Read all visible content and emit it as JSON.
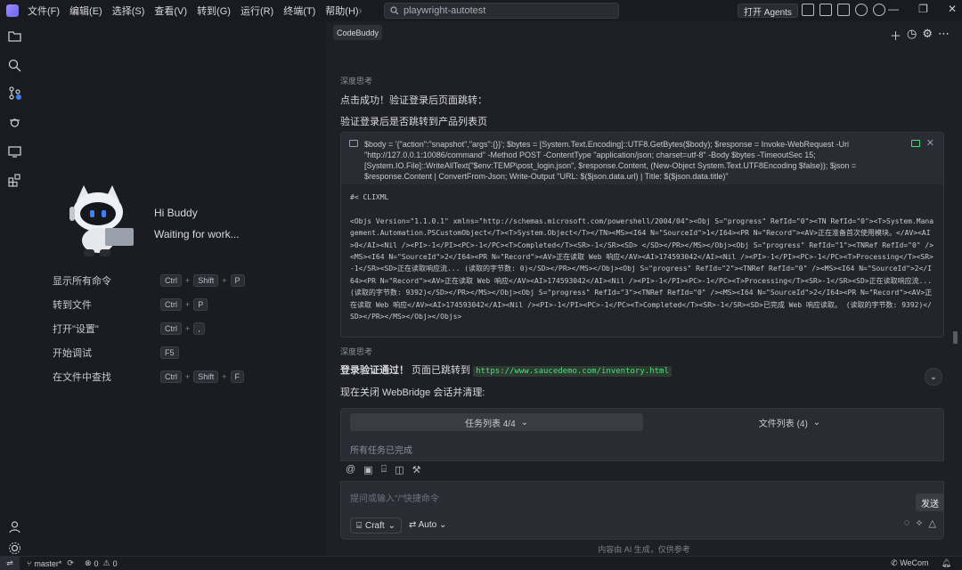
{
  "menu": [
    "文件(F)",
    "编辑(E)",
    "选择(S)",
    "查看(V)",
    "转到(G)",
    "运行(R)",
    "终端(T)",
    "帮助(H)"
  ],
  "search": {
    "value": "playwright-autotest"
  },
  "titlebar": {
    "agents_label": "打开 Agents"
  },
  "welcome": {
    "greeting": "Hi Buddy",
    "status": "Waiting for work...",
    "commands": [
      {
        "label": "显示所有命令",
        "keys": [
          "Ctrl",
          "Shift",
          "P"
        ]
      },
      {
        "label": "转到文件",
        "keys": [
          "Ctrl",
          "P"
        ]
      },
      {
        "label": "打开\"设置\"",
        "keys": [
          "Ctrl",
          ","
        ]
      },
      {
        "label": "开始调试",
        "keys": [
          "F5"
        ]
      },
      {
        "label": "在文件中查找",
        "keys": [
          "Ctrl",
          "Shift",
          "F"
        ]
      }
    ]
  },
  "chat": {
    "tab_label": "CodeBuddy",
    "thinking_label_1": "深度思考",
    "msg1": "点击成功！验证登录后页面跳转：",
    "msg2": "验证登录后是否跳转到产品列表页",
    "command": "$body = '{\"action\":\"snapshot\",\"args\":{}}'; $bytes = [System.Text.Encoding]::UTF8.GetBytes($body); $response = Invoke-WebRequest -Uri \"http://127.0.0.1:10086/command\" -Method POST -ContentType \"application/json; charset=utf-8\" -Body $bytes -TimeoutSec 15; [System.IO.File]::WriteAllText(\"$env:TEMP\\post_login.json\", $response.Content, (New-Object System.Text.UTF8Encoding $false)); $json = $response.Content | ConvertFrom-Json; Write-Output \"URL: $($json.data.url) | Title: $($json.data.title)\"",
    "output": "#< CLIXML\n\n<Objs Version=\"1.1.0.1\" xmlns=\"http://schemas.microsoft.com/powershell/2004/04\"><Obj S=\"progress\" RefId=\"0\"><TN RefId=\"0\"><T>System.Management.Automation.PSCustomObject</T><T>System.Object</T></TN><MS><I64 N=\"SourceId\">1</I64><PR N=\"Record\"><AV>正在准备首次使用模块。</AV><AI>0</AI><Nil /><PI>-1</PI><PC>-1</PC><T>Completed</T><SR>-1</SR><SD> </SD></PR></MS></Obj><Obj S=\"progress\" RefId=\"1\"><TNRef RefId=\"0\" /><MS><I64 N=\"SourceId\">2</I64><PR N=\"Record\"><AV>正在读取 Web 响应</AV><AI>174593042</AI><Nil /><PI>-1</PI><PC>-1</PC><T>Processing</T><SR>-1</SR><SD>正在读取响应流... (读取的字节数: 0)</SD></PR></MS></Obj><Obj S=\"progress\" RefId=\"2\"><TNRef RefId=\"0\" /><MS><I64 N=\"SourceId\">2</I64><PR N=\"Record\"><AV>正在读取 Web 响应</AV><AI>174593042</AI><Nil /><PI>-1</PI><PC>-1</PC><T>Processing</T><SR>-1</SR><SD>正在读取响应流... (读取的字节数: 9392)</SD></PR></MS></Obj><Obj S=\"progress\" RefId=\"3\"><TNRef RefId=\"0\" /><MS><I64 N=\"SourceId\">2</I64><PR N=\"Record\"><AV>正在读取 Web 响应</AV><AI>174593042</AI><Nil /><PI>-1</PI><PC>-1</PC><T>Completed</T><SR>-1</SR><SD>已完成 Web 响应读取。 (读取的字节数: 9392)</SD></PR></MS></Obj></Objs>",
    "thinking_label_2": "深度思考",
    "msg3_bold": "登录验证通过！",
    "msg3_text": " 页面已跳转到 ",
    "msg3_link": "https://www.saucedemo.com/inventory.html",
    "msg4": "现在关闭 WebBridge 会话并清理:",
    "task_tab_1": "任务列表 4/4",
    "task_tab_2": "文件列表 (4)",
    "task_status": "所有任务已完成",
    "input_placeholder": "提问或输入\"/\"快捷命令",
    "craft_label": "Craft",
    "auto_label": "Auto",
    "send_tooltip": "发送",
    "disclaimer": "内容由 AI 生成，仅供参考"
  },
  "statusbar": {
    "branch": "master*",
    "errors": "0",
    "warnings": "0",
    "account": "WeCom"
  }
}
